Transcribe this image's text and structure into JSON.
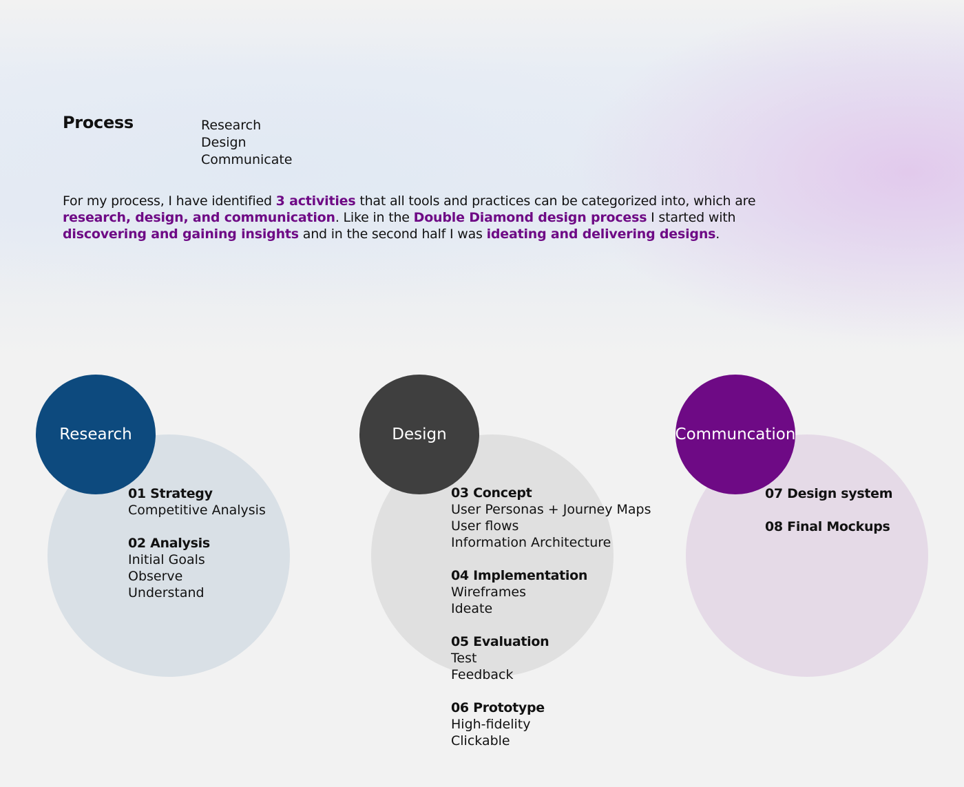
{
  "header": {
    "title": "Process",
    "activities": [
      "Research",
      "Design",
      "Communicate"
    ]
  },
  "intro": [
    {
      "text": "For my process, I have identified ",
      "highlight": false
    },
    {
      "text": "3 activities",
      "highlight": true
    },
    {
      "text": " that all tools and practices can be categorized into, which are ",
      "highlight": false
    },
    {
      "text": "research, design, and communication",
      "highlight": true
    },
    {
      "text": ". Like in the ",
      "highlight": false
    },
    {
      "text": "Double Diamond design process",
      "highlight": true
    },
    {
      "text": " I started with ",
      "highlight": false
    },
    {
      "text": "discovering and gaining insights",
      "highlight": true
    },
    {
      "text": " and in the second half I was ",
      "highlight": false
    },
    {
      "text": "ideating and delivering designs",
      "highlight": true
    },
    {
      "text": ".",
      "highlight": false
    }
  ],
  "colors": {
    "highlight": "#6e0a85",
    "research": "#0d4a7e",
    "research_light": "#d9e0e6",
    "design": "#3f3f3f",
    "design_light": "#e0e0e0",
    "communication": "#6e0a85",
    "communication_light": "#e5dae7"
  },
  "phases": [
    {
      "label": "Research",
      "steps": [
        {
          "title": "01 Strategy",
          "items": [
            "Competitive Analysis"
          ]
        },
        {
          "title": "02 Analysis",
          "items": [
            "Initial Goals",
            "Observe",
            "Understand"
          ]
        }
      ]
    },
    {
      "label": "Design",
      "steps": [
        {
          "title": "03 Concept",
          "items": [
            "User Personas + Journey Maps",
            "User flows",
            "Information Architecture"
          ]
        },
        {
          "title": "04 Implementation",
          "items": [
            "Wireframes",
            "Ideate"
          ]
        },
        {
          "title": "05 Evaluation",
          "items": [
            "Test",
            "Feedback"
          ]
        },
        {
          "title": "06 Prototype",
          "items": [
            "High-fidelity",
            "Clickable"
          ]
        }
      ]
    },
    {
      "label": "Communcation",
      "steps": [
        {
          "title": "07 Design system",
          "items": []
        },
        {
          "title": "08 Final Mockups",
          "items": []
        }
      ]
    }
  ]
}
